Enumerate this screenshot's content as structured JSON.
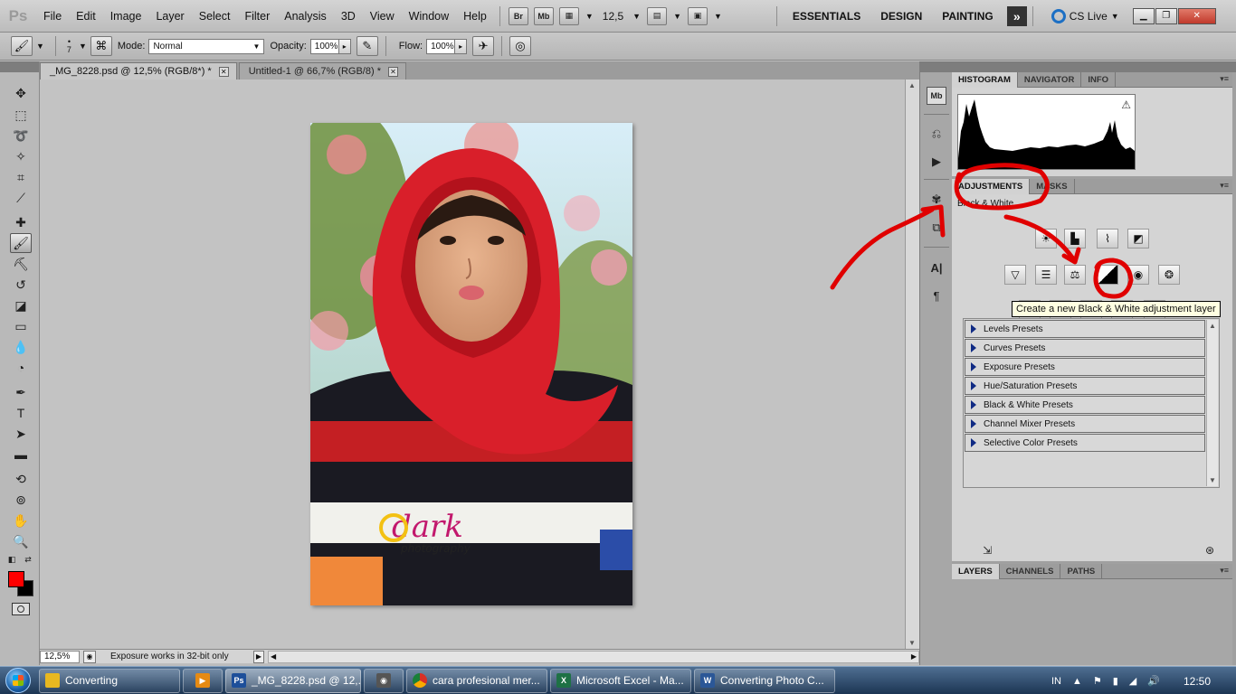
{
  "app": {
    "logo": "Ps"
  },
  "menu": [
    "File",
    "Edit",
    "Image",
    "Layer",
    "Select",
    "Filter",
    "Analysis",
    "3D",
    "View",
    "Window",
    "Help"
  ],
  "menubar": {
    "bridge_label": "Br",
    "minibridge_label": "Mb",
    "zoom_value": "12,5",
    "workspaces": [
      "ESSENTIALS",
      "DESIGN",
      "PAINTING"
    ],
    "more_workspaces": "»",
    "cs_live": "CS Live"
  },
  "options": {
    "brush_size": "7",
    "mode_label": "Mode:",
    "mode_value": "Normal",
    "opacity_label": "Opacity:",
    "opacity_value": "100%",
    "flow_label": "Flow:",
    "flow_value": "100%"
  },
  "tabs": [
    {
      "label": "_MG_8228.psd @ 12,5% (RGB/8*) *",
      "active": true
    },
    {
      "label": "Untitled-1 @ 66,7% (RGB/8) *",
      "active": false
    }
  ],
  "status": {
    "zoom": "12,5%",
    "info": "Exposure works in 32-bit only"
  },
  "photo_watermark": {
    "line1": "dark",
    "line2": "photography"
  },
  "panels": {
    "group1_tabs": [
      "HISTOGRAM",
      "NAVIGATOR",
      "INFO"
    ],
    "histogram_warning": "⚠",
    "group2_tabs": [
      "ADJUSTMENTS",
      "MASKS"
    ],
    "adjustment_title": "Black & White",
    "tooltip": "Create a new Black & White adjustment layer",
    "presets": [
      "Levels Presets",
      "Curves Presets",
      "Exposure Presets",
      "Hue/Saturation Presets",
      "Black & White Presets",
      "Channel Mixer Presets",
      "Selective Color Presets"
    ],
    "group3_tabs": [
      "LAYERS",
      "CHANNELS",
      "PATHS"
    ]
  },
  "taskbar": {
    "items": [
      {
        "label": "Converting",
        "color": "#e8b820"
      },
      {
        "label": "",
        "color": "#e58a13"
      },
      {
        "label": "_MG_8228.psd @ 12,...",
        "color": "#1d4f9a",
        "active": true
      },
      {
        "label": "",
        "color": "#555555"
      },
      {
        "label": "cara profesional mer...",
        "color": "#d93025"
      },
      {
        "label": "Microsoft Excel - Ma...",
        "color": "#1e7145"
      },
      {
        "label": "Converting Photo C...",
        "color": "#2b5797"
      }
    ],
    "language": "IN",
    "clock": "12:50"
  },
  "colors": {
    "foreground": "#ff0000",
    "background": "#000000",
    "annotation": "#e00000"
  }
}
